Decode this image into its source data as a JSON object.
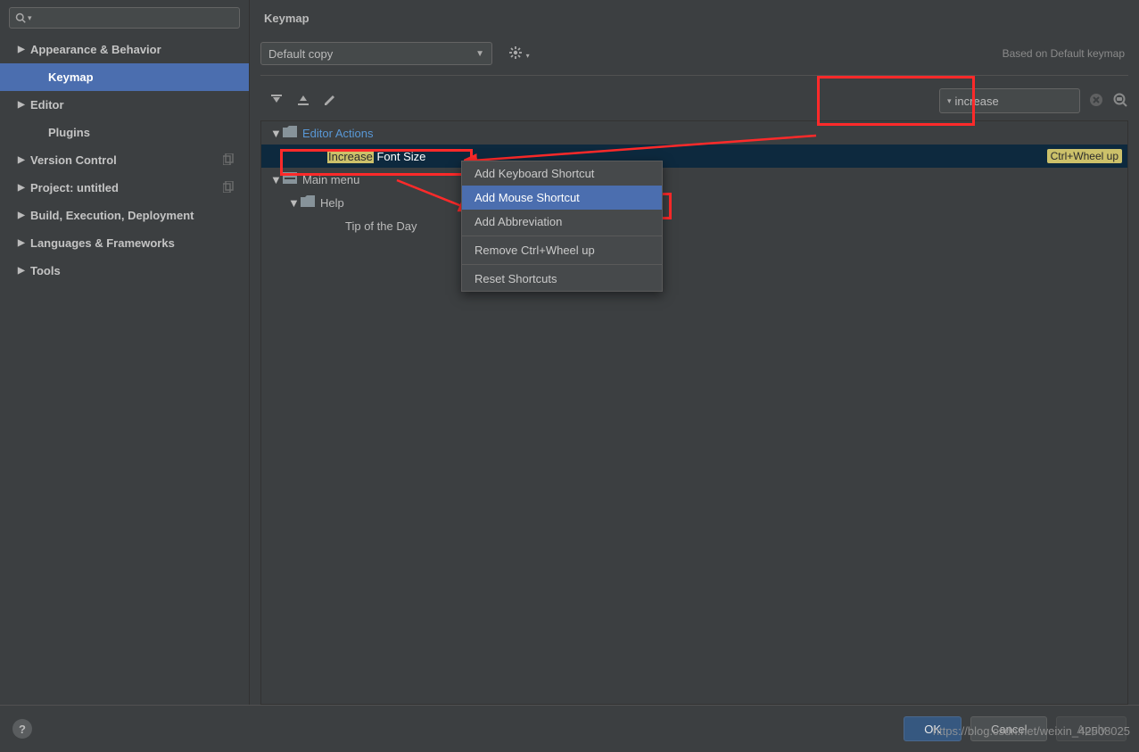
{
  "sidebar": {
    "search_placeholder": "",
    "items": [
      {
        "label": "Appearance & Behavior",
        "expandable": true
      },
      {
        "label": "Keymap",
        "expandable": false,
        "child": true,
        "selected": true
      },
      {
        "label": "Editor",
        "expandable": true
      },
      {
        "label": "Plugins",
        "expandable": false,
        "child": true
      },
      {
        "label": "Version Control",
        "expandable": true,
        "copy": true
      },
      {
        "label": "Project: untitled",
        "expandable": true,
        "copy": true
      },
      {
        "label": "Build, Execution, Deployment",
        "expandable": true
      },
      {
        "label": "Languages & Frameworks",
        "expandable": true
      },
      {
        "label": "Tools",
        "expandable": true
      }
    ]
  },
  "main": {
    "title": "Keymap",
    "dropdown_value": "Default copy",
    "based_on": "Based on Default keymap",
    "filter_value": "increase"
  },
  "tree": {
    "rows": [
      {
        "label": "Editor Actions",
        "type": "folder-link"
      },
      {
        "pre": "Increase",
        "post": " Font Size",
        "shortcut": "Ctrl+Wheel up",
        "type": "leaf-selected"
      },
      {
        "label": "Main menu",
        "type": "folder"
      },
      {
        "label": "Help",
        "type": "subfolder"
      },
      {
        "label": "Tip of the Day",
        "type": "leaf"
      }
    ]
  },
  "context_menu": {
    "items": [
      "Add Keyboard Shortcut",
      "Add Mouse Shortcut",
      "Add Abbreviation",
      "Remove Ctrl+Wheel up",
      "Reset Shortcuts"
    ],
    "highlighted_index": 1
  },
  "footer": {
    "ok": "OK",
    "cancel": "Cancel",
    "apply": "Apply"
  },
  "watermark": "https://blog.csdn.net/weixin_42508025"
}
